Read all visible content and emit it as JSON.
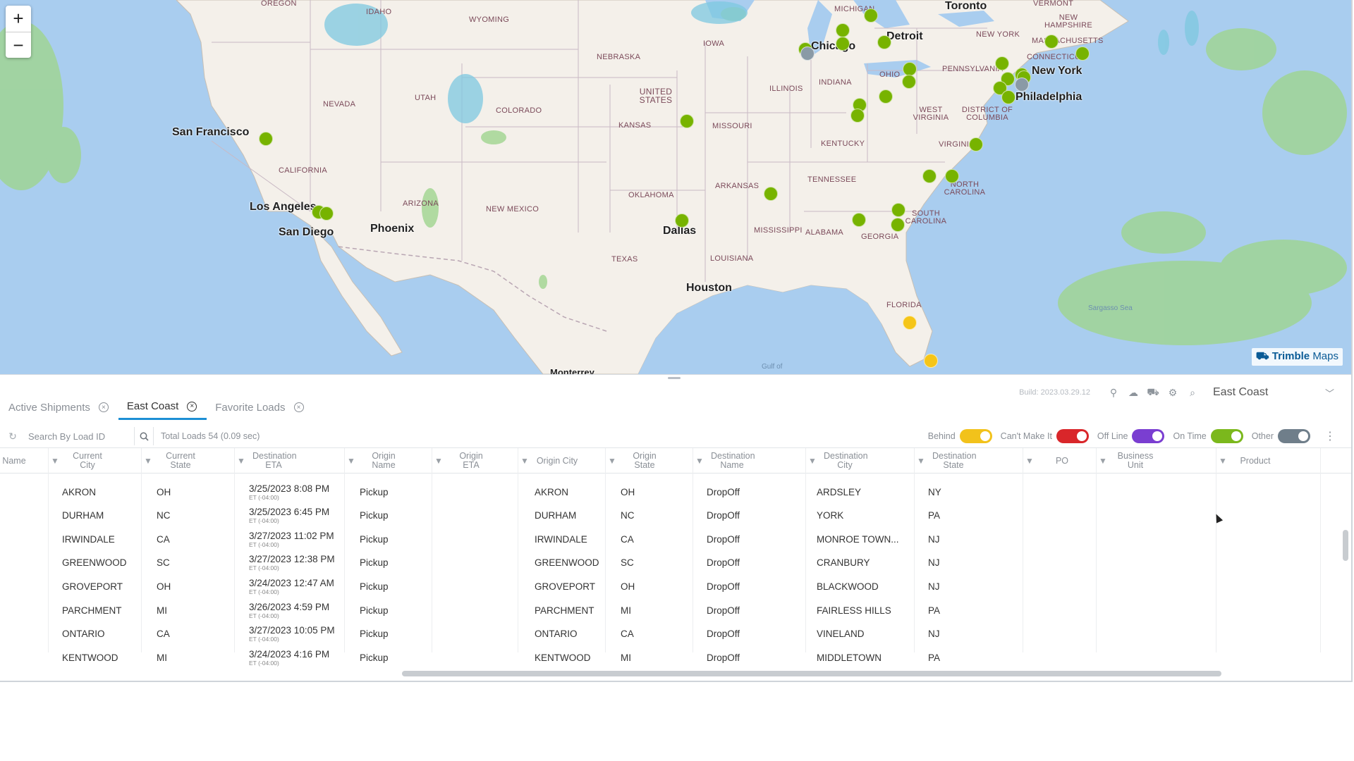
{
  "map": {
    "zoom_in": "+",
    "zoom_out": "−",
    "attribution": {
      "brand": "Trimble",
      "suffix": "Maps"
    },
    "cities": [
      "Toronto",
      "Chicago",
      "Detroit",
      "New York",
      "Philadelphia",
      "San Francisco",
      "Los Angeles",
      "San Diego",
      "Phoenix",
      "Dallas",
      "Houston",
      "Monterrey"
    ],
    "states": [
      "OREGON",
      "IDAHO",
      "WYOMING",
      "NEBRASKA",
      "IOWA",
      "MICHIGAN",
      "VERMONT",
      "NEW HAMPSHIRE",
      "MASSACHUSETTS",
      "CONNECTICUT",
      "NEW YORK",
      "PENNSYLVANIA",
      "NEVADA",
      "UTAH",
      "COLORADO",
      "UNITED STATES",
      "KANSAS",
      "MISSOURI",
      "ILLINOIS",
      "INDIANA",
      "OHIO",
      "WEST VIRGINIA",
      "DISTRICT OF COLUMBIA",
      "VIRGINIA",
      "KENTUCKY",
      "CALIFORNIA",
      "ARIZONA",
      "NEW MEXICO",
      "OKLAHOMA",
      "ARKANSAS",
      "TENNESSEE",
      "NORTH CAROLINA",
      "SOUTH CAROLINA",
      "MISSISSIPPI",
      "ALABAMA",
      "GEORGIA",
      "TEXAS",
      "LOUISIANA",
      "FLORIDA",
      "Sargasso Sea",
      "Gulf of"
    ],
    "marker_colors": {
      "on_time": "#77b300",
      "behind": "#f5c518",
      "other": "#8a9aa6"
    }
  },
  "panel": {
    "build": "Build: 2023.03.29.12",
    "region": "East Coast",
    "tabs": [
      {
        "label": "Active Shipments",
        "active": false
      },
      {
        "label": "East Coast",
        "active": true
      },
      {
        "label": "Favorite Loads",
        "active": false
      }
    ],
    "search": {
      "placeholder": "Search By Load ID"
    },
    "total": "Total Loads 54 (0.09 sec)",
    "toggles": [
      {
        "label": "Behind",
        "color": "#f2c21b"
      },
      {
        "label": "Can't Make It",
        "color": "#d9262a"
      },
      {
        "label": "Off Line",
        "color": "#7a3ed1"
      },
      {
        "label": "On Time",
        "color": "#7bb81c"
      },
      {
        "label": "Other",
        "color": "#6f7e8a"
      }
    ]
  },
  "grid": {
    "columns": [
      "Name",
      "Current City",
      "Current State",
      "Destination ETA",
      "Origin Name",
      "Origin ETA",
      "Origin City",
      "Origin State",
      "Destination Name",
      "Destination City",
      "Destination State",
      "PO",
      "Business Unit",
      "Product"
    ],
    "rows": [
      {
        "city": "AKRON",
        "state": "OH",
        "eta": "3/25/2023  8:08 PM",
        "tz": "ET (-04:00)",
        "origin_name": "Pickup",
        "origin_city": "AKRON",
        "origin_state": "OH",
        "dest_name": "DropOff",
        "dest_city": "ARDSLEY",
        "dest_state": "NY"
      },
      {
        "city": "DURHAM",
        "state": "NC",
        "eta": "3/25/2023  6:45 PM",
        "tz": "ET (-04:00)",
        "origin_name": "Pickup",
        "origin_city": "DURHAM",
        "origin_state": "NC",
        "dest_name": "DropOff",
        "dest_city": "YORK",
        "dest_state": "PA"
      },
      {
        "city": "IRWINDALE",
        "state": "CA",
        "eta": "3/27/2023  11:02 PM",
        "tz": "ET (-04:00)",
        "origin_name": "Pickup",
        "origin_city": "IRWINDALE",
        "origin_state": "CA",
        "dest_name": "DropOff",
        "dest_city": "MONROE TOWN...",
        "dest_state": "NJ"
      },
      {
        "city": "GREENWOOD",
        "state": "SC",
        "eta": "3/27/2023  12:38 PM",
        "tz": "ET (-04:00)",
        "origin_name": "Pickup",
        "origin_city": "GREENWOOD",
        "origin_state": "SC",
        "dest_name": "DropOff",
        "dest_city": "CRANBURY",
        "dest_state": "NJ"
      },
      {
        "city": "GROVEPORT",
        "state": "OH",
        "eta": "3/24/2023  12:47 AM",
        "tz": "ET (-04:00)",
        "origin_name": "Pickup",
        "origin_city": "GROVEPORT",
        "origin_state": "OH",
        "dest_name": "DropOff",
        "dest_city": "BLACKWOOD",
        "dest_state": "NJ"
      },
      {
        "city": "PARCHMENT",
        "state": "MI",
        "eta": "3/26/2023  4:59 PM",
        "tz": "ET (-04:00)",
        "origin_name": "Pickup",
        "origin_city": "PARCHMENT",
        "origin_state": "MI",
        "dest_name": "DropOff",
        "dest_city": "FAIRLESS HILLS",
        "dest_state": "PA"
      },
      {
        "city": "ONTARIO",
        "state": "CA",
        "eta": "3/27/2023  10:05 PM",
        "tz": "ET (-04:00)",
        "origin_name": "Pickup",
        "origin_city": "ONTARIO",
        "origin_state": "CA",
        "dest_name": "DropOff",
        "dest_city": "VINELAND",
        "dest_state": "NJ"
      },
      {
        "city": "KENTWOOD",
        "state": "MI",
        "eta": "3/24/2023  4:16 PM",
        "tz": "ET (-04:00)",
        "origin_name": "Pickup",
        "origin_city": "KENTWOOD",
        "origin_state": "MI",
        "dest_name": "DropOff",
        "dest_city": "MIDDLETOWN",
        "dest_state": "PA"
      }
    ]
  }
}
